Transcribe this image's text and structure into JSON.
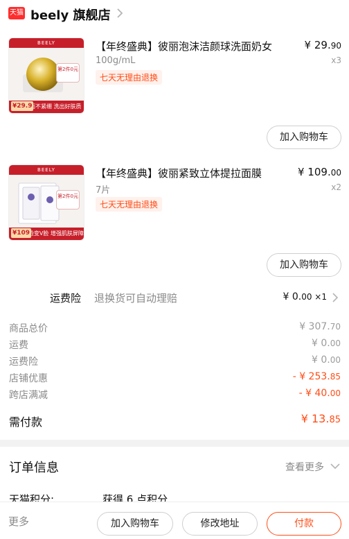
{
  "store": {
    "badge": "天猫",
    "name": "beely 旗舰店"
  },
  "products": [
    {
      "title": "【年终盛典】彼丽泡沫洁颜球洗面奶女",
      "spec": "100g/mL",
      "tag": "七天无理由退换",
      "price_int": "¥ 29.",
      "price_dec": "90",
      "qty": "x3",
      "action": "加入购物车",
      "image": {
        "top": "BEELY",
        "promo": "第2件0元",
        "price": "¥29.9",
        "caption": "洗面不紧绷 洗出好肤质"
      }
    },
    {
      "title": "【年终盛典】彼丽紧致立体提拉面膜",
      "spec": "7片",
      "tag": "七天无理由退换",
      "price_int": "¥ 109.",
      "price_dec": "00",
      "qty": "x2",
      "action": "加入购物车",
      "image": {
        "top": "BEELY",
        "promo": "第2件0元",
        "price": "¥109",
        "caption": "U脸变V脸 增强肌肤屏障"
      }
    }
  ],
  "insurance": {
    "label": "运费险",
    "desc": "退换货可自动理赔",
    "value_int": "¥ 0.",
    "value_dec": "00",
    "mult": " ×1"
  },
  "summary": [
    {
      "label": "商品总价",
      "value_int": "¥ 307.",
      "value_dec": "70",
      "style": "gray"
    },
    {
      "label": "运费",
      "value_int": "¥ 0.",
      "value_dec": "00",
      "style": "gray"
    },
    {
      "label": "运费险",
      "value_int": "¥ 0.",
      "value_dec": "00",
      "style": "gray"
    },
    {
      "label": "店铺优惠",
      "value_int": "- ¥ 253.",
      "value_dec": "85",
      "style": "orange"
    },
    {
      "label": "跨店满减",
      "value_int": "- ¥ 40.",
      "value_dec": "00",
      "style": "orange"
    }
  ],
  "total": {
    "label": "需付款",
    "value_int": "¥ 13.",
    "value_dec": "85"
  },
  "order_info": {
    "title": "订单信息",
    "more": "查看更多"
  },
  "points": {
    "label": "天猫积分:",
    "value": "获得 6 点积分"
  },
  "bottom_bar": {
    "more": "更多",
    "add_cart": "加入购物车",
    "edit_address": "修改地址",
    "pay": "付款"
  },
  "colors": {
    "accent": "#ff4d17",
    "tmall_red": "#ff2d2d",
    "text_gray": "#8a8a8a"
  }
}
